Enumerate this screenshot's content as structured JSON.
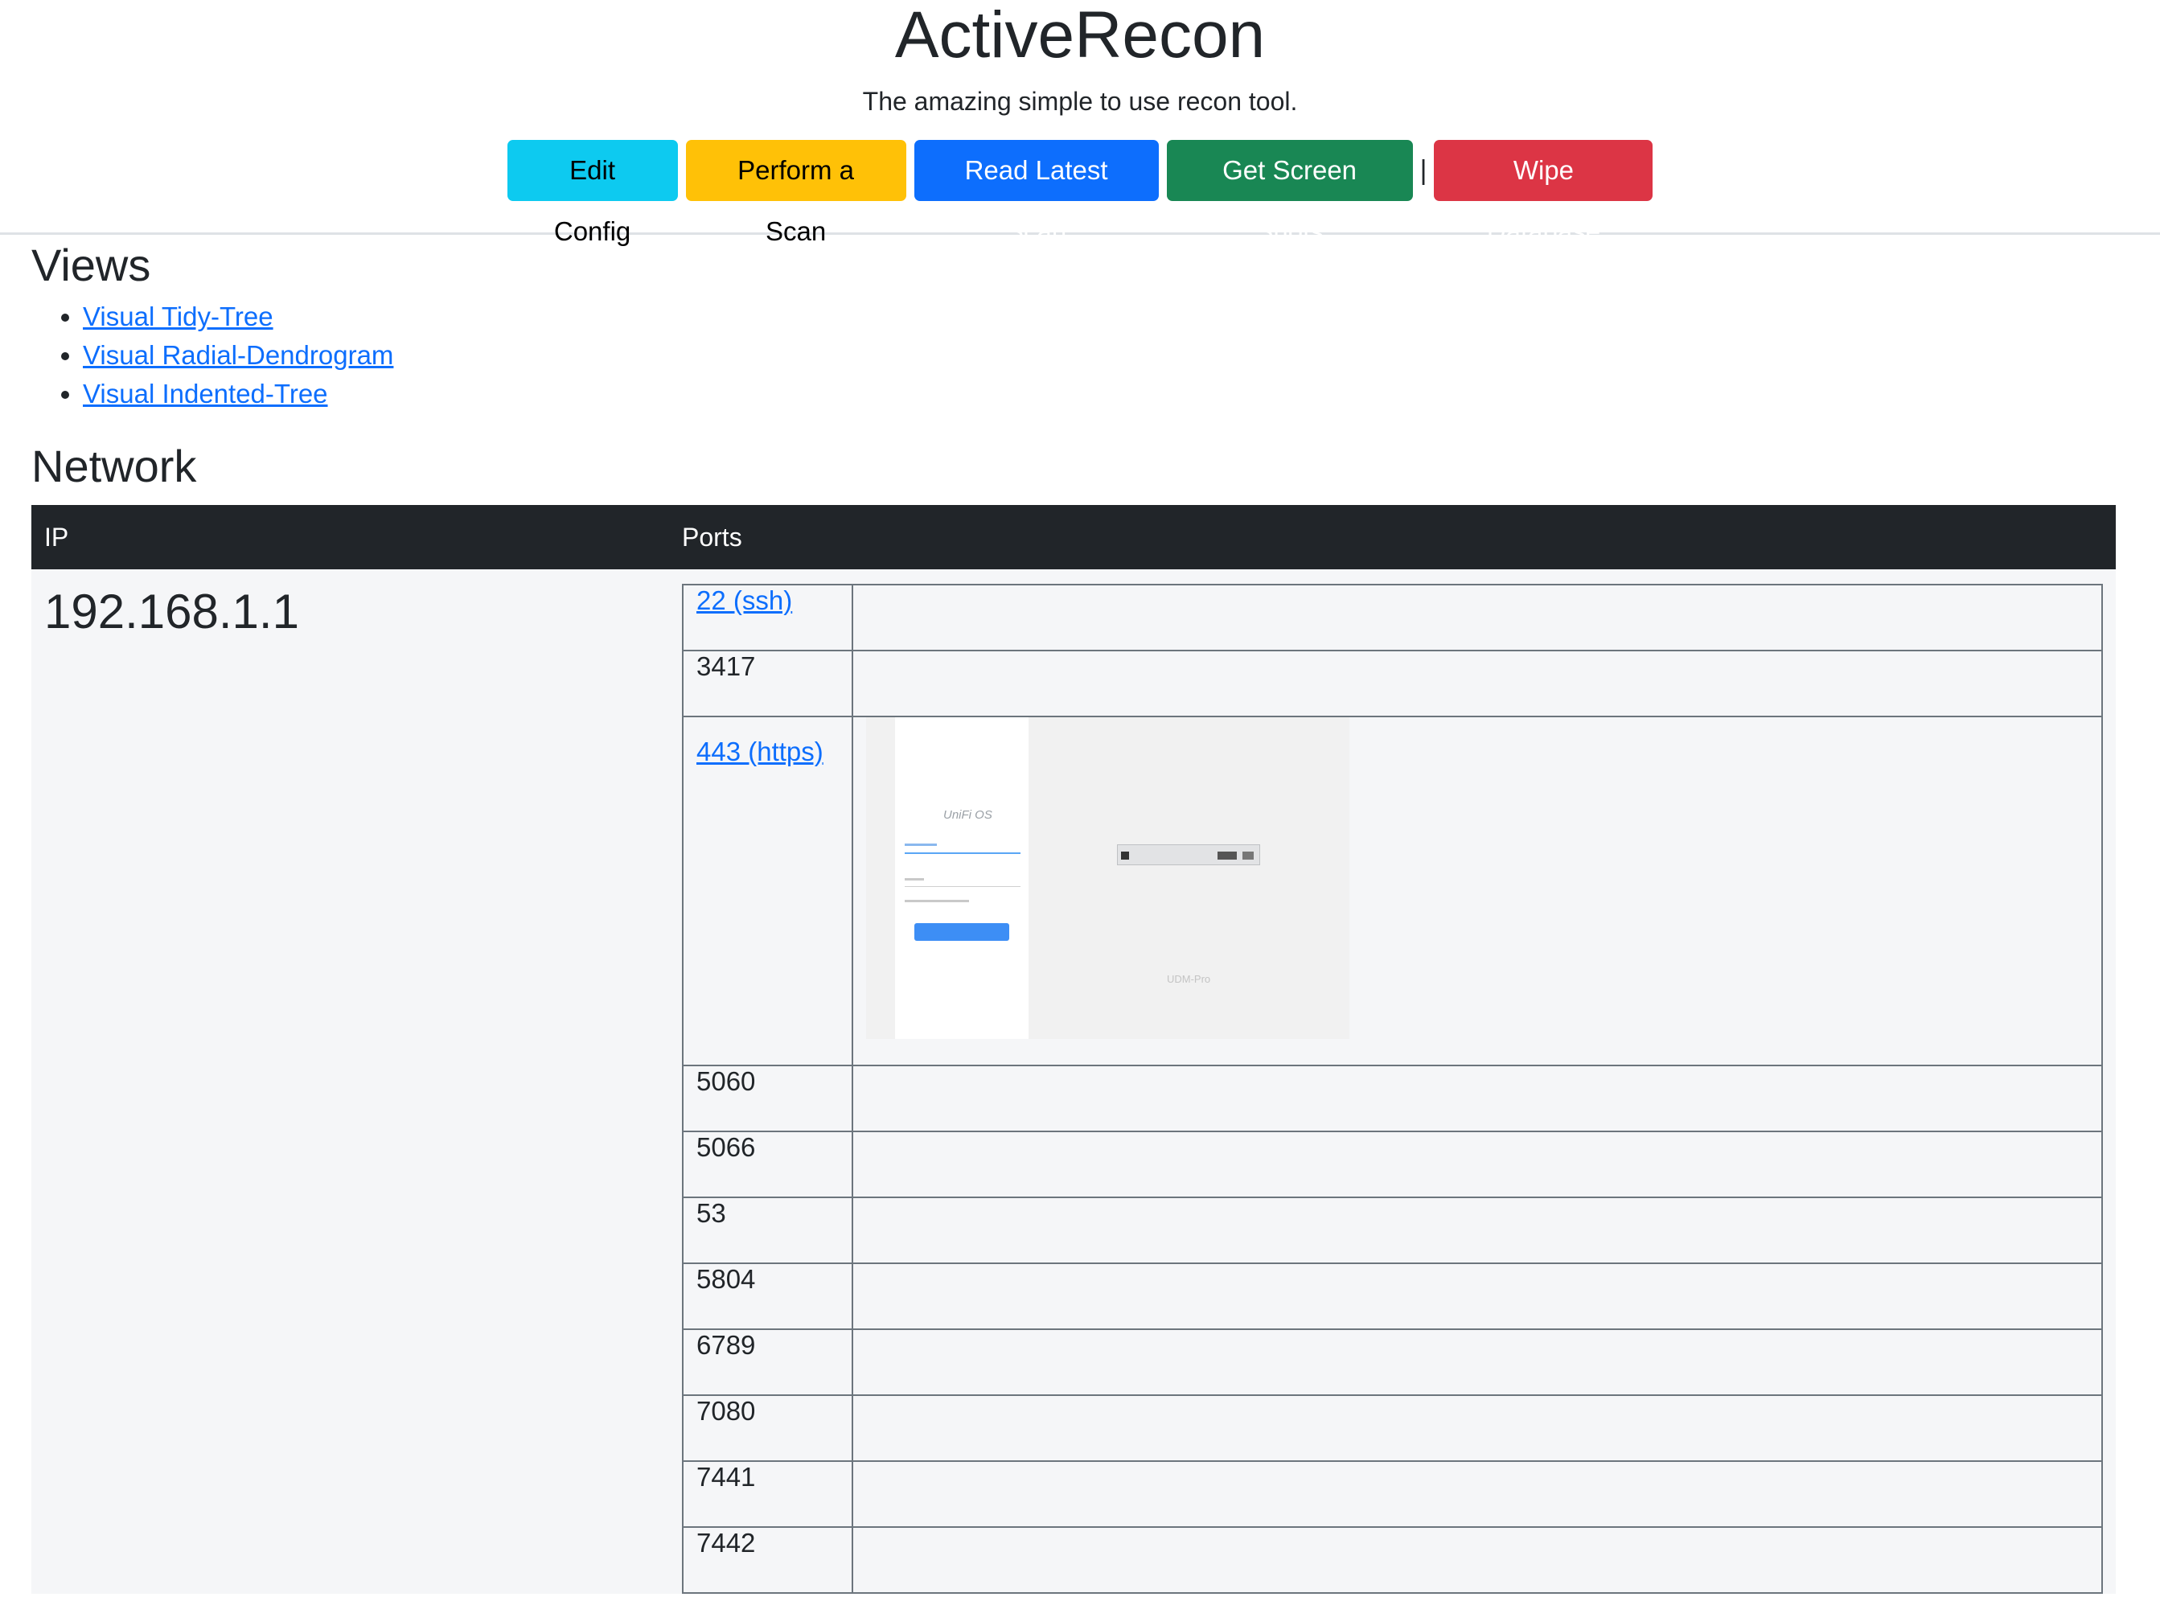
{
  "header": {
    "title": "ActiveRecon",
    "subtitle": "The amazing simple to use recon tool.",
    "buttons": {
      "edit_config": "Edit Config",
      "perform_scan": "Perform a Scan",
      "read_latest_scan": "Read Latest Scan",
      "get_screen_shots": "Get Screen Shots",
      "separator": "|",
      "wipe_database": "Wipe Database"
    }
  },
  "views": {
    "heading": "Views",
    "links": [
      "Visual Tidy-Tree",
      "Visual Radial-Dendrogram",
      "Visual Indented-Tree"
    ]
  },
  "network": {
    "heading": "Network",
    "columns": {
      "ip": "IP",
      "ports": "Ports"
    },
    "hosts": [
      {
        "ip": "192.168.1.1",
        "ports": [
          {
            "label": "22 (ssh)",
            "link": true
          },
          {
            "label": "3417",
            "link": false
          },
          {
            "label": "443 (https)",
            "link": true,
            "screenshot": {
              "logo": "UniFi OS",
              "device_label": "UDM-Pro"
            }
          },
          {
            "label": "5060",
            "link": false
          },
          {
            "label": "5066",
            "link": false
          },
          {
            "label": "53",
            "link": false
          },
          {
            "label": "5804",
            "link": false
          },
          {
            "label": "6789",
            "link": false
          },
          {
            "label": "7080",
            "link": false
          },
          {
            "label": "7441",
            "link": false
          },
          {
            "label": "7442",
            "link": false
          }
        ]
      }
    ]
  }
}
